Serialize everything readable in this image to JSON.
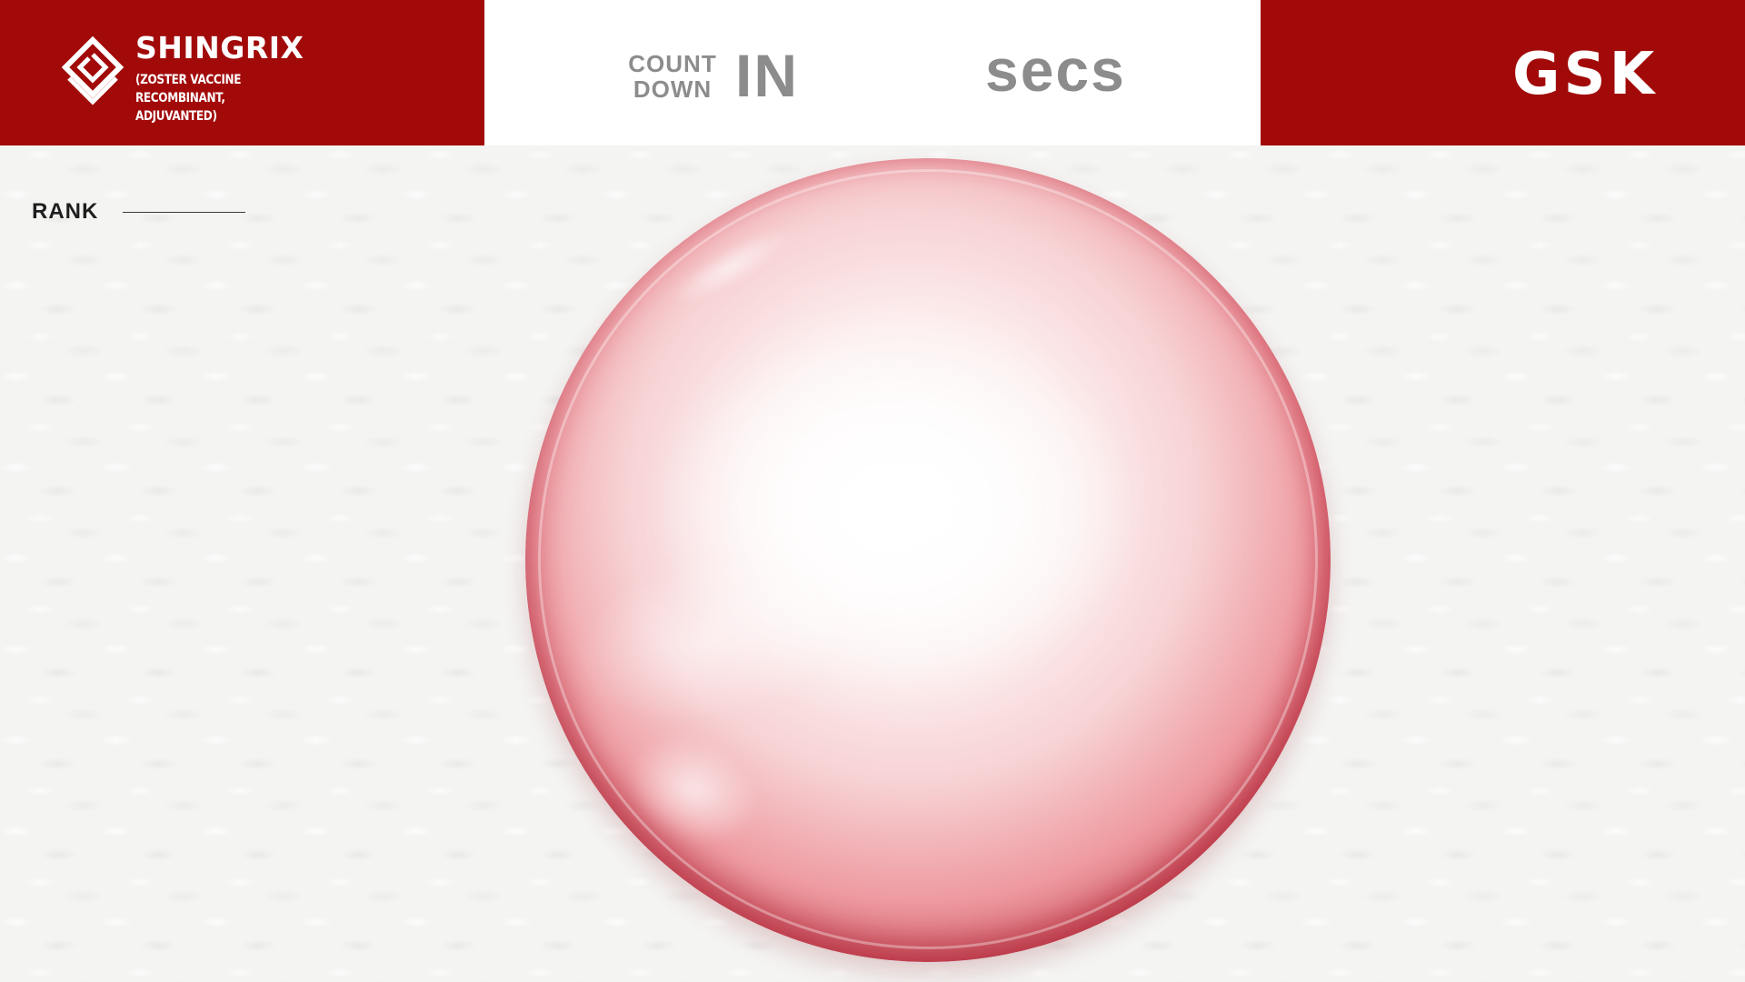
{
  "brand": {
    "name": "SHINGRIX",
    "subtitle": "(ZOSTER VACCINE RECOMBINANT, ADJUVANTED)"
  },
  "countdown": {
    "label": "COUNT DOWN",
    "prefix": "IN",
    "value": "",
    "unit": "secs"
  },
  "company": {
    "logo_text": "GSK"
  },
  "rank": {
    "label": "RANK"
  },
  "icons": {
    "brand_logo": "shingrix-logo-icon",
    "company_logo": "gsk-logo-icon",
    "bubble": "game-bubble"
  },
  "colors": {
    "brand_red": "#a20a0a",
    "header_white": "#ffffff",
    "timer_text": "#8c8c8c",
    "background": "#f4f4f3",
    "bubble_rim": "#c91f33"
  }
}
